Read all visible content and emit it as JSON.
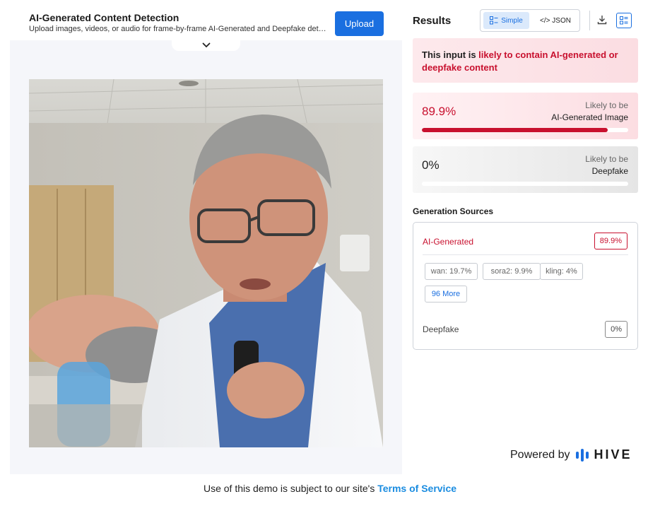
{
  "header": {
    "title": "AI-Generated Content Detection",
    "subtitle": "Upload images, videos, or audio for frame-by-frame AI-Generated and Deepfake detection with…",
    "upload_label": "Upload",
    "collapse_icon": "chevron-down-icon"
  },
  "results": {
    "title": "Results",
    "toggle": {
      "simple_label": "Simple",
      "json_label": "</> JSON",
      "active": "Simple"
    },
    "icons": [
      "download-icon",
      "view-list-icon"
    ],
    "verdict": {
      "prefix": "This input is ",
      "highlight": "likely to contain AI-generated or deepfake content"
    },
    "cards": [
      {
        "percent_text": "89.9%",
        "likely_text": "Likely to be",
        "label": "AI-Generated Image",
        "value": 0.899,
        "color": "#c8102e"
      },
      {
        "percent_text": "0%",
        "likely_text": "Likely to be",
        "label": "Deepfake",
        "value": 0.0,
        "color": "#c8102e"
      }
    ],
    "generation_sources": {
      "title": "Generation Sources",
      "ai_label": "AI-Generated",
      "ai_value": "89.9%",
      "chips": [
        "wan: 19.7%",
        "sora2: 9.9%",
        "kling: 4%"
      ],
      "more_label": "96 More",
      "deepfake_label": "Deepfake",
      "deepfake_value": "0%"
    }
  },
  "powered_by": {
    "prefix": "Powered by",
    "brand": "HIVE"
  },
  "footer": {
    "text": "Use of this demo is subject to our site's ",
    "link": "Terms of Service"
  },
  "colors": {
    "accent": "#1a6fe0",
    "danger": "#c8102e",
    "link": "#1a8ce0"
  }
}
